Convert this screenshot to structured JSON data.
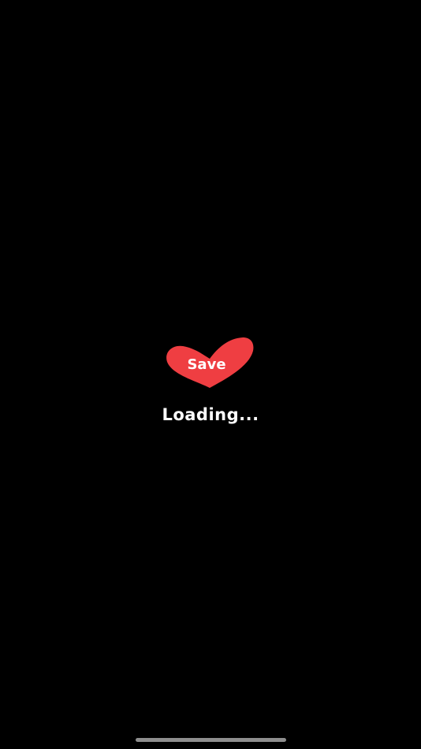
{
  "splash": {
    "logo_text": "Save",
    "logo_icon": "heart-icon",
    "loading_text": "Loading..."
  },
  "colors": {
    "background": "#000000",
    "accent": "#EF3E42",
    "text": "#FFFFFF",
    "home_indicator": "#8E8E8E"
  }
}
